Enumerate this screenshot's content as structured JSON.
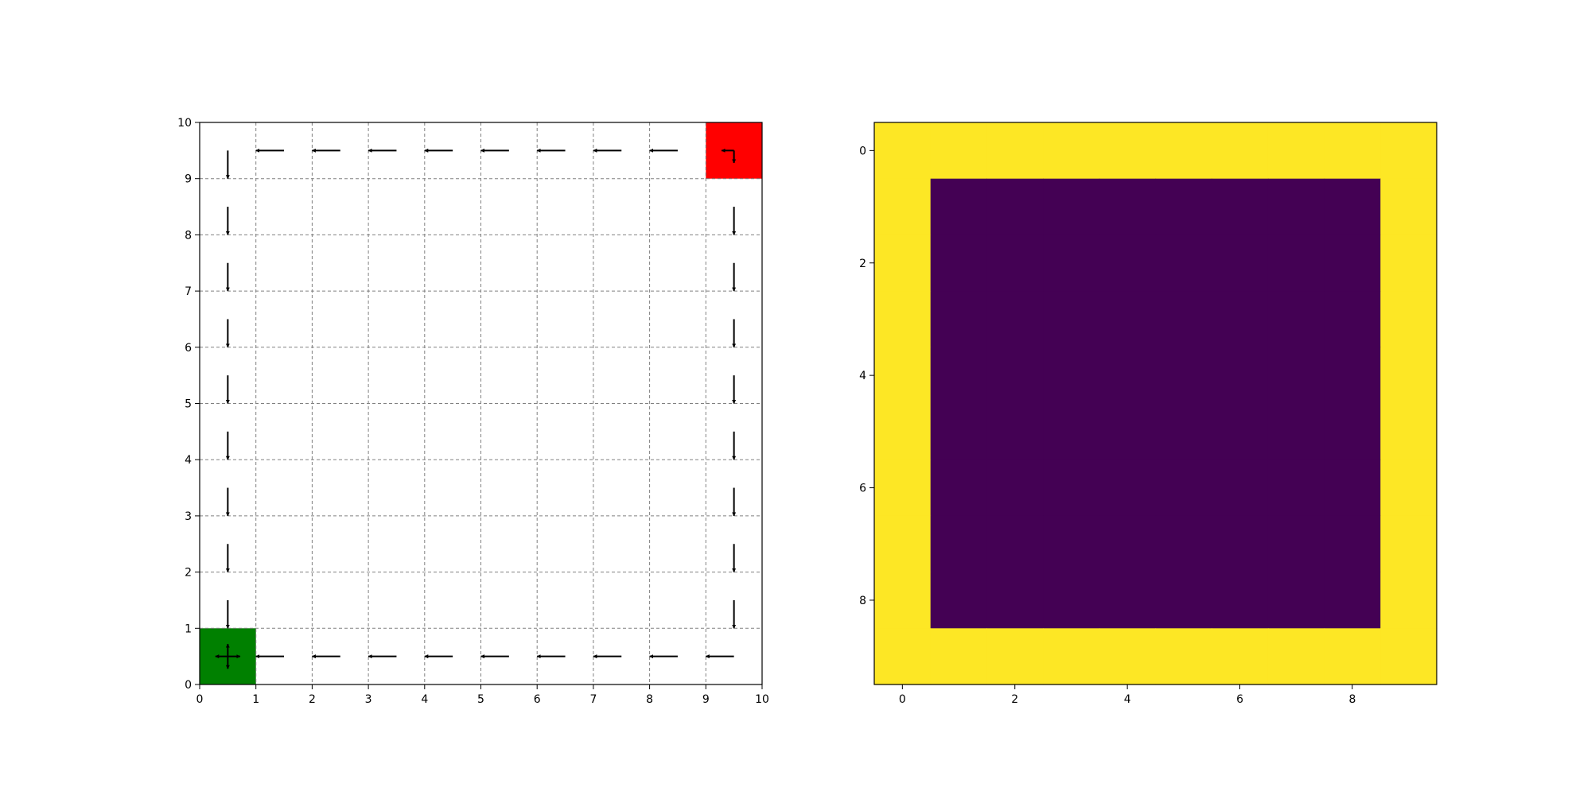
{
  "chart_data": [
    {
      "type": "grid-policy",
      "xlim": [
        0,
        10
      ],
      "ylim": [
        0,
        10
      ],
      "xticks": [
        0,
        1,
        2,
        3,
        4,
        5,
        6,
        7,
        8,
        9,
        10
      ],
      "yticks": [
        0,
        1,
        2,
        3,
        4,
        5,
        6,
        7,
        8,
        9,
        10
      ],
      "grid": true,
      "grid_style": "dashed",
      "colors": {
        "goal": "#008000",
        "start": "#ff0000",
        "arrow": "#000000",
        "grid": "#808080"
      },
      "special_cells": [
        {
          "name": "goal-cell",
          "x": 0,
          "y": 0,
          "color": "#008000"
        },
        {
          "name": "start-cell",
          "x": 9,
          "y": 9,
          "color": "#ff0000"
        }
      ],
      "arrows": [
        {
          "x": 0.5,
          "y": 0.5,
          "dirs": [
            "up",
            "down",
            "left",
            "right"
          ]
        },
        {
          "x": 9.5,
          "y": 9.5,
          "dirs": [
            "left",
            "down"
          ]
        },
        {
          "x": 0.5,
          "y": 9.5,
          "dirs": [
            "down"
          ]
        },
        {
          "x": 0.5,
          "y": 8.5,
          "dirs": [
            "down"
          ]
        },
        {
          "x": 0.5,
          "y": 7.5,
          "dirs": [
            "down"
          ]
        },
        {
          "x": 0.5,
          "y": 6.5,
          "dirs": [
            "down"
          ]
        },
        {
          "x": 0.5,
          "y": 5.5,
          "dirs": [
            "down"
          ]
        },
        {
          "x": 0.5,
          "y": 4.5,
          "dirs": [
            "down"
          ]
        },
        {
          "x": 0.5,
          "y": 3.5,
          "dirs": [
            "down"
          ]
        },
        {
          "x": 0.5,
          "y": 2.5,
          "dirs": [
            "down"
          ]
        },
        {
          "x": 0.5,
          "y": 1.5,
          "dirs": [
            "down"
          ]
        },
        {
          "x": 9.5,
          "y": 8.5,
          "dirs": [
            "down"
          ]
        },
        {
          "x": 9.5,
          "y": 7.5,
          "dirs": [
            "down"
          ]
        },
        {
          "x": 9.5,
          "y": 6.5,
          "dirs": [
            "down"
          ]
        },
        {
          "x": 9.5,
          "y": 5.5,
          "dirs": [
            "down"
          ]
        },
        {
          "x": 9.5,
          "y": 4.5,
          "dirs": [
            "down"
          ]
        },
        {
          "x": 9.5,
          "y": 3.5,
          "dirs": [
            "down"
          ]
        },
        {
          "x": 9.5,
          "y": 2.5,
          "dirs": [
            "down"
          ]
        },
        {
          "x": 9.5,
          "y": 1.5,
          "dirs": [
            "down"
          ]
        },
        {
          "x": 1.5,
          "y": 9.5,
          "dirs": [
            "left"
          ]
        },
        {
          "x": 2.5,
          "y": 9.5,
          "dirs": [
            "left"
          ]
        },
        {
          "x": 3.5,
          "y": 9.5,
          "dirs": [
            "left"
          ]
        },
        {
          "x": 4.5,
          "y": 9.5,
          "dirs": [
            "left"
          ]
        },
        {
          "x": 5.5,
          "y": 9.5,
          "dirs": [
            "left"
          ]
        },
        {
          "x": 6.5,
          "y": 9.5,
          "dirs": [
            "left"
          ]
        },
        {
          "x": 7.5,
          "y": 9.5,
          "dirs": [
            "left"
          ]
        },
        {
          "x": 8.5,
          "y": 9.5,
          "dirs": [
            "left"
          ]
        },
        {
          "x": 1.5,
          "y": 0.5,
          "dirs": [
            "left"
          ]
        },
        {
          "x": 2.5,
          "y": 0.5,
          "dirs": [
            "left"
          ]
        },
        {
          "x": 3.5,
          "y": 0.5,
          "dirs": [
            "left"
          ]
        },
        {
          "x": 4.5,
          "y": 0.5,
          "dirs": [
            "left"
          ]
        },
        {
          "x": 5.5,
          "y": 0.5,
          "dirs": [
            "left"
          ]
        },
        {
          "x": 6.5,
          "y": 0.5,
          "dirs": [
            "left"
          ]
        },
        {
          "x": 7.5,
          "y": 0.5,
          "dirs": [
            "left"
          ]
        },
        {
          "x": 8.5,
          "y": 0.5,
          "dirs": [
            "left"
          ]
        },
        {
          "x": 9.5,
          "y": 0.5,
          "dirs": [
            "left"
          ]
        }
      ]
    },
    {
      "type": "heatmap",
      "colormap": "viridis",
      "rows": 10,
      "cols": 10,
      "xticks": [
        0,
        2,
        4,
        6,
        8
      ],
      "yticks": [
        0,
        2,
        4,
        6,
        8
      ],
      "y_inverted": true,
      "colors": {
        "high": "#fde725",
        "low": "#440154"
      },
      "values": [
        [
          1,
          1,
          1,
          1,
          1,
          1,
          1,
          1,
          1,
          1
        ],
        [
          1,
          0,
          0,
          0,
          0,
          0,
          0,
          0,
          0,
          1
        ],
        [
          1,
          0,
          0,
          0,
          0,
          0,
          0,
          0,
          0,
          1
        ],
        [
          1,
          0,
          0,
          0,
          0,
          0,
          0,
          0,
          0,
          1
        ],
        [
          1,
          0,
          0,
          0,
          0,
          0,
          0,
          0,
          0,
          1
        ],
        [
          1,
          0,
          0,
          0,
          0,
          0,
          0,
          0,
          0,
          1
        ],
        [
          1,
          0,
          0,
          0,
          0,
          0,
          0,
          0,
          0,
          1
        ],
        [
          1,
          0,
          0,
          0,
          0,
          0,
          0,
          0,
          0,
          1
        ],
        [
          1,
          0,
          0,
          0,
          0,
          0,
          0,
          0,
          0,
          1
        ],
        [
          1,
          1,
          1,
          1,
          1,
          1,
          1,
          1,
          1,
          1
        ]
      ]
    }
  ]
}
